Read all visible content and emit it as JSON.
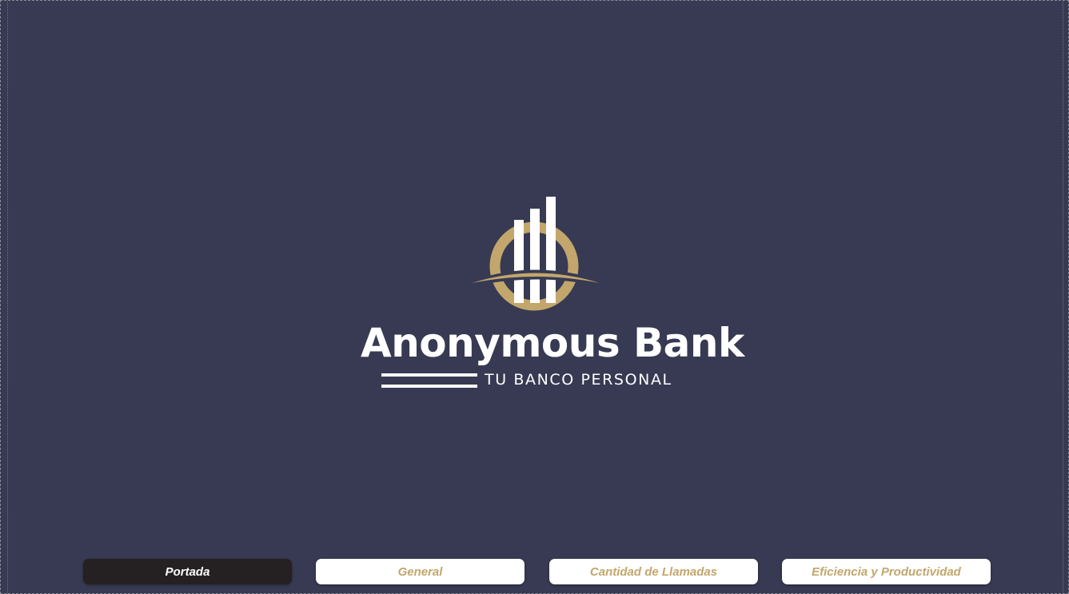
{
  "brand": {
    "name": "Anonymous Bank",
    "tagline": "TU BANCO PERSONAL",
    "logo_icon": "bar-chart-circle-icon"
  },
  "colors": {
    "background": "#373a52",
    "gold": "#c3a66c",
    "white": "#ffffff",
    "active_button": "#252122"
  },
  "nav": {
    "items": [
      {
        "label": "Portada",
        "active": true
      },
      {
        "label": "General",
        "active": false
      },
      {
        "label": "Cantidad de Llamadas",
        "active": false
      },
      {
        "label": "Eficiencia y Productividad",
        "active": false
      }
    ]
  }
}
